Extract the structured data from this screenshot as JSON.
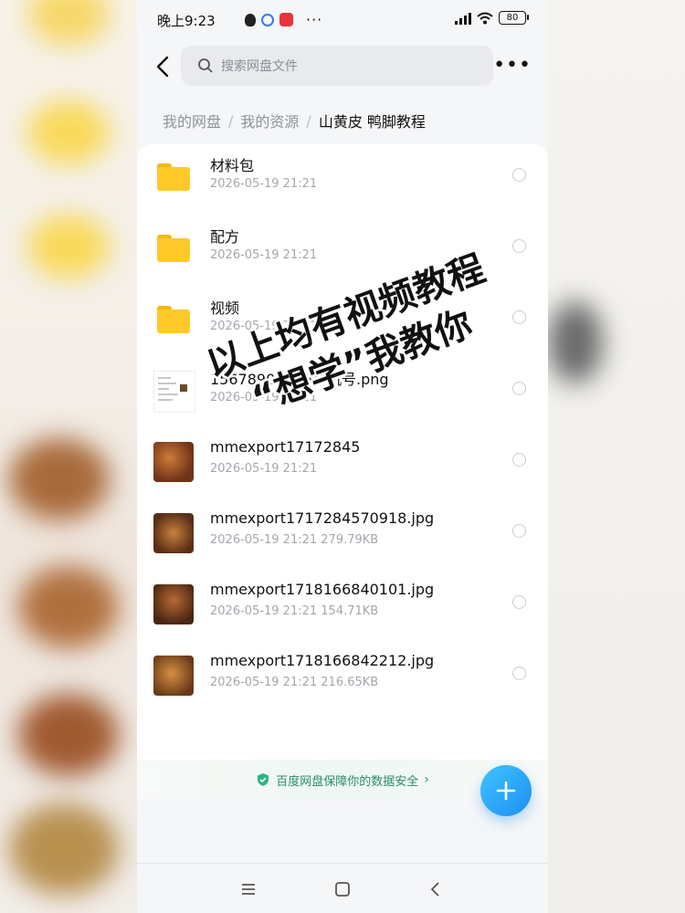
{
  "status_bar": {
    "time": "晚上9:23",
    "battery": "80",
    "more_dots": "···"
  },
  "search": {
    "placeholder": "搜索网盘文件"
  },
  "more_menu": "•••",
  "breadcrumb": {
    "items": [
      "我的网盘",
      "我的资源"
    ],
    "separator": "/",
    "current": "山黄皮 鸭脚教程"
  },
  "files": [
    {
      "name": "材料包",
      "meta": "2026-05-19   21:21",
      "type": "folder"
    },
    {
      "name": "配方",
      "meta": "2026-05-19   21:21",
      "type": "folder"
    },
    {
      "name": "视频",
      "meta": "2026-05-19   21:21",
      "type": "folder"
    },
    {
      "name": "15678902476手机号.png",
      "meta": "2026-05-19   21:21",
      "type": "image-doc"
    },
    {
      "name": "mmexport17172845",
      "meta": "2026-05-19   21:21",
      "type": "image-food"
    },
    {
      "name": "mmexport1717284570918.jpg",
      "meta": "2026-05-19   21:21   279.79KB",
      "type": "image-food"
    },
    {
      "name": "mmexport1718166840101.jpg",
      "meta": "2026-05-19   21:21   154.71KB",
      "type": "image-food"
    },
    {
      "name": "mmexport1718166842212.jpg",
      "meta": "2026-05-19   21:21   216.65KB",
      "type": "image-food"
    }
  ],
  "overlay": {
    "line1": "以上均有视频教程",
    "line2": "“想学”我教你"
  },
  "security_banner": {
    "text": "百度网盘保障你的数据安全",
    "chevron": "›"
  },
  "colors": {
    "accent": "#1e8ff2",
    "folder": "#ffc929",
    "security_green": "#2b8b6e"
  }
}
